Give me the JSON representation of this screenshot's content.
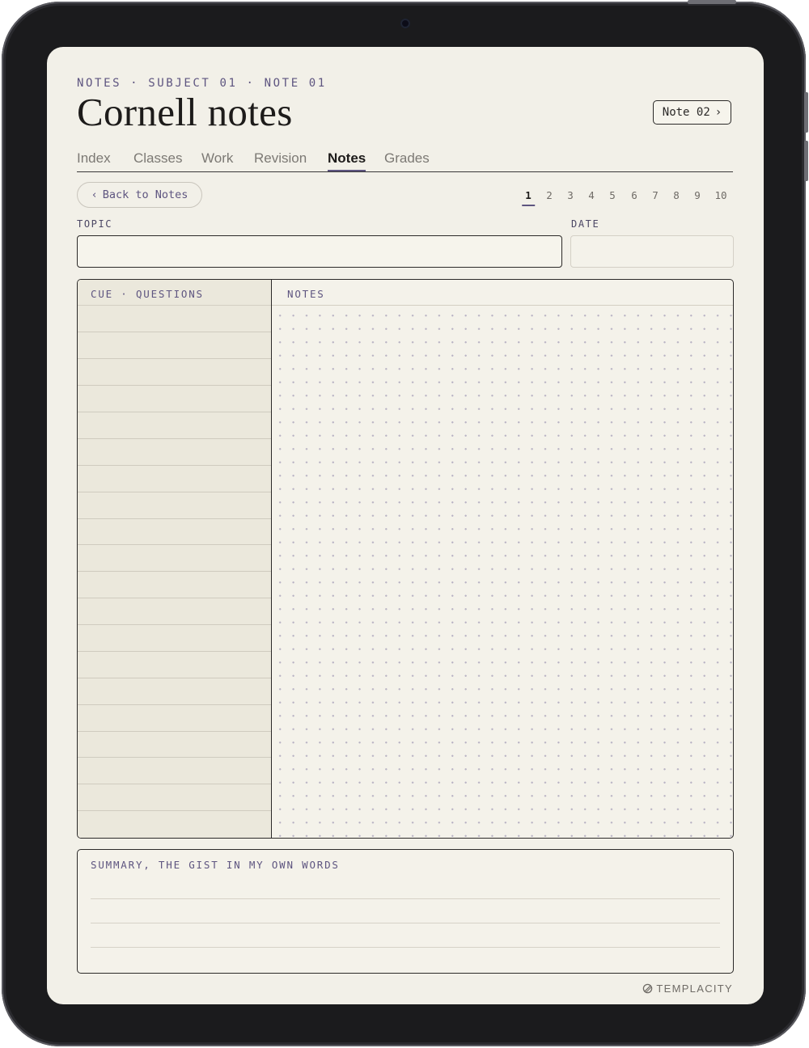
{
  "breadcrumb": "NOTES · SUBJECT 01 · NOTE 01",
  "title": "Cornell notes",
  "next_note_label": "Note 02",
  "tabs": [
    {
      "label": "Index",
      "active": false
    },
    {
      "label": "Classes",
      "active": false
    },
    {
      "label": "Work",
      "active": false
    },
    {
      "label": "Revision",
      "active": false
    },
    {
      "label": "Notes",
      "active": true
    },
    {
      "label": "Grades",
      "active": false
    }
  ],
  "back_label": "Back to Notes",
  "pages": [
    "1",
    "2",
    "3",
    "4",
    "5",
    "6",
    "7",
    "8",
    "9",
    "10"
  ],
  "current_page": "1",
  "topic": {
    "label": "TOPIC",
    "value": "",
    "placeholder": ""
  },
  "date": {
    "label": "DATE",
    "value": "",
    "placeholder": ""
  },
  "cue_header": "CUE · QUESTIONS",
  "notes_header": "NOTES",
  "summary_label": "SUMMARY, THE GIST IN MY OWN WORDS",
  "brand": "TEMPLACITY",
  "colors": {
    "accent": "#5e5580",
    "paper": "#f2f0e8",
    "cue_column": "#ebe8dc",
    "ink": "#1d1b1a"
  },
  "icons": {
    "back": "chevron-left-icon",
    "next": "chevron-right-icon",
    "brand": "templacity-logo-icon"
  }
}
